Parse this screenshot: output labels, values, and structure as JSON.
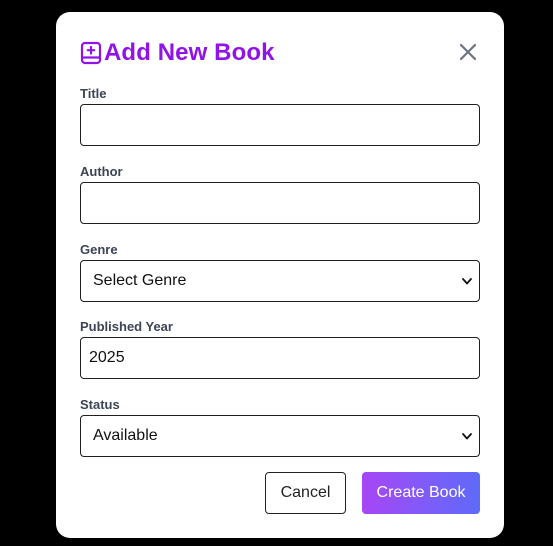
{
  "modal": {
    "title": "Add New Book",
    "icon": "book-plus-icon",
    "accent_color": "#9013e8"
  },
  "fields": {
    "title": {
      "label": "Title",
      "value": ""
    },
    "author": {
      "label": "Author",
      "value": ""
    },
    "genre": {
      "label": "Genre",
      "selected": "Select Genre"
    },
    "published_year": {
      "label": "Published Year",
      "value": "2025"
    },
    "status": {
      "label": "Status",
      "selected": "Available"
    }
  },
  "actions": {
    "cancel_label": "Cancel",
    "create_label": "Create Book",
    "create_gradient": [
      "#a746f5",
      "#5f6af9"
    ]
  }
}
